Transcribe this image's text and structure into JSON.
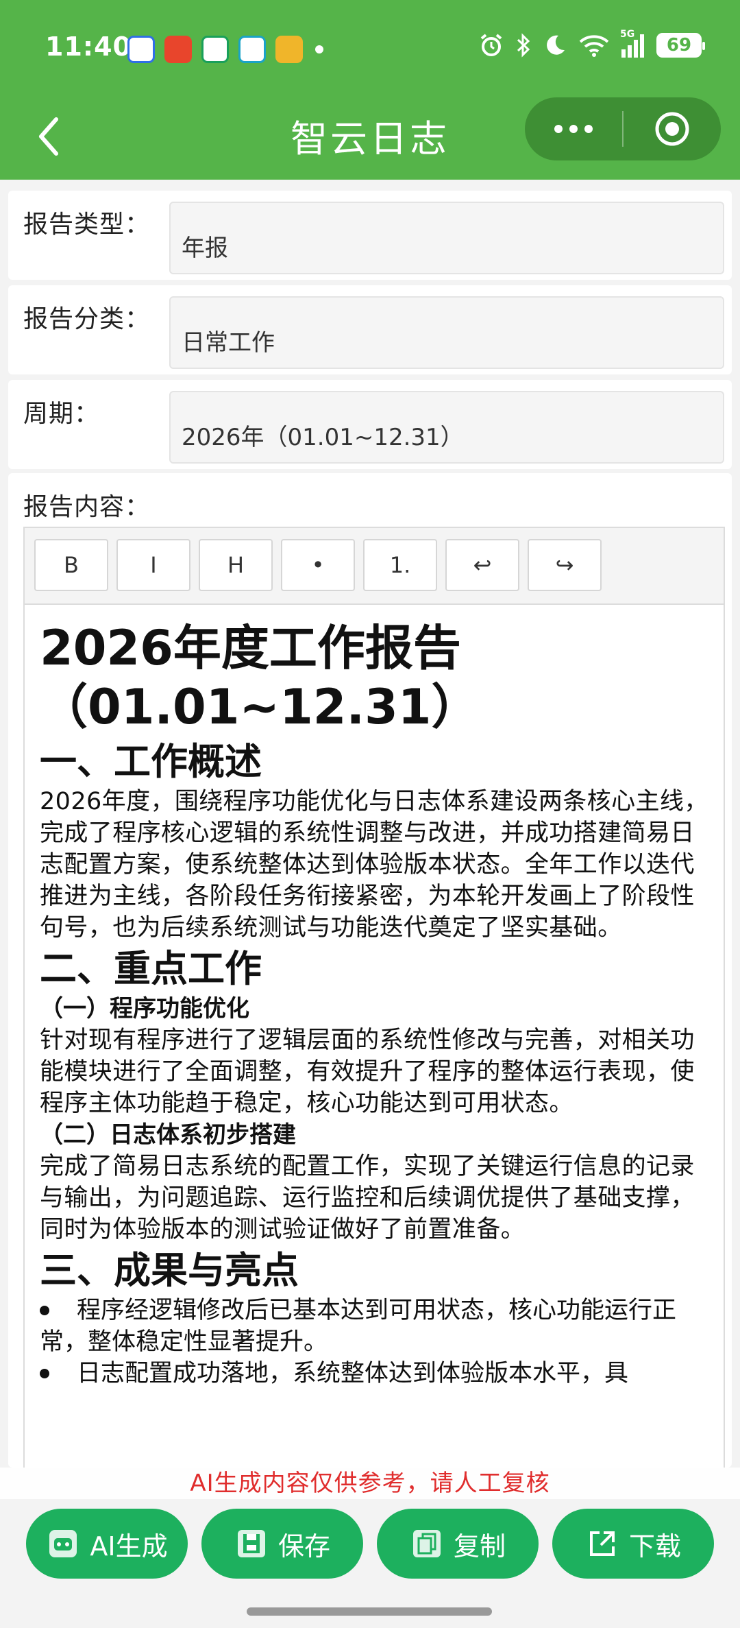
{
  "status_bar": {
    "time": "11:40",
    "network": "5G",
    "battery": "69"
  },
  "header": {
    "title": "智云日志"
  },
  "form": {
    "report_type": {
      "label": "报告类型：",
      "value": "年报"
    },
    "report_category": {
      "label": "报告分类：",
      "value": "日常工作"
    },
    "period": {
      "label": "周期：",
      "value": "2026年（01.01~12.31）"
    },
    "content_label": "报告内容："
  },
  "toolbar": {
    "bold": "B",
    "italic": "I",
    "heading": "H",
    "bullet": "•",
    "ordered": "1.",
    "undo": "↩",
    "redo": "↪"
  },
  "document": {
    "title_line1": "2026年度工作报告",
    "title_line2": "（01.01~12.31）",
    "s1_heading": "一、工作概述",
    "s1_body": "2026年度，围绕程序功能优化与日志体系建设两条核心主线，完成了程序核心逻辑的系统性调整与改进，并成功搭建简易日志配置方案，使系统整体达到体验版本状态。全年工作以迭代推进为主线，各阶段任务衔接紧密，为本轮开发画上了阶段性句号，也为后续系统测试与功能迭代奠定了坚实基础。",
    "s2_heading": "二、重点工作",
    "s2_sub1": "（一）程序功能优化",
    "s2_body1": "针对现有程序进行了逻辑层面的系统性修改与完善，对相关功能模块进行了全面调整，有效提升了程序的整体运行表现，使程序主体功能趋于稳定，核心功能达到可用状态。",
    "s2_sub2": "（二）日志体系初步搭建",
    "s2_body2": "完成了简易日志系统的配置工作，实现了关键运行信息的记录与输出，为问题追踪、运行监控和后续调优提供了基础支撑，同时为体验版本的测试验证做好了前置准备。",
    "s3_heading": "三、成果与亮点",
    "s3_item1": "程序经逻辑修改后已基本达到可用状态，核心功能运行正常，整体稳定性显著提升。",
    "s3_item2": "日志配置成功落地，系统整体达到体验版本水平，具"
  },
  "disclaimer": "AI生成内容仅供参考，请人工复核",
  "actions": {
    "ai_generate": "AI生成",
    "save": "保存",
    "copy": "复制",
    "download": "下载"
  },
  "colors": {
    "header_green": "#55b449",
    "button_green": "#1db05e",
    "disclaimer_red": "#e02d2d"
  }
}
